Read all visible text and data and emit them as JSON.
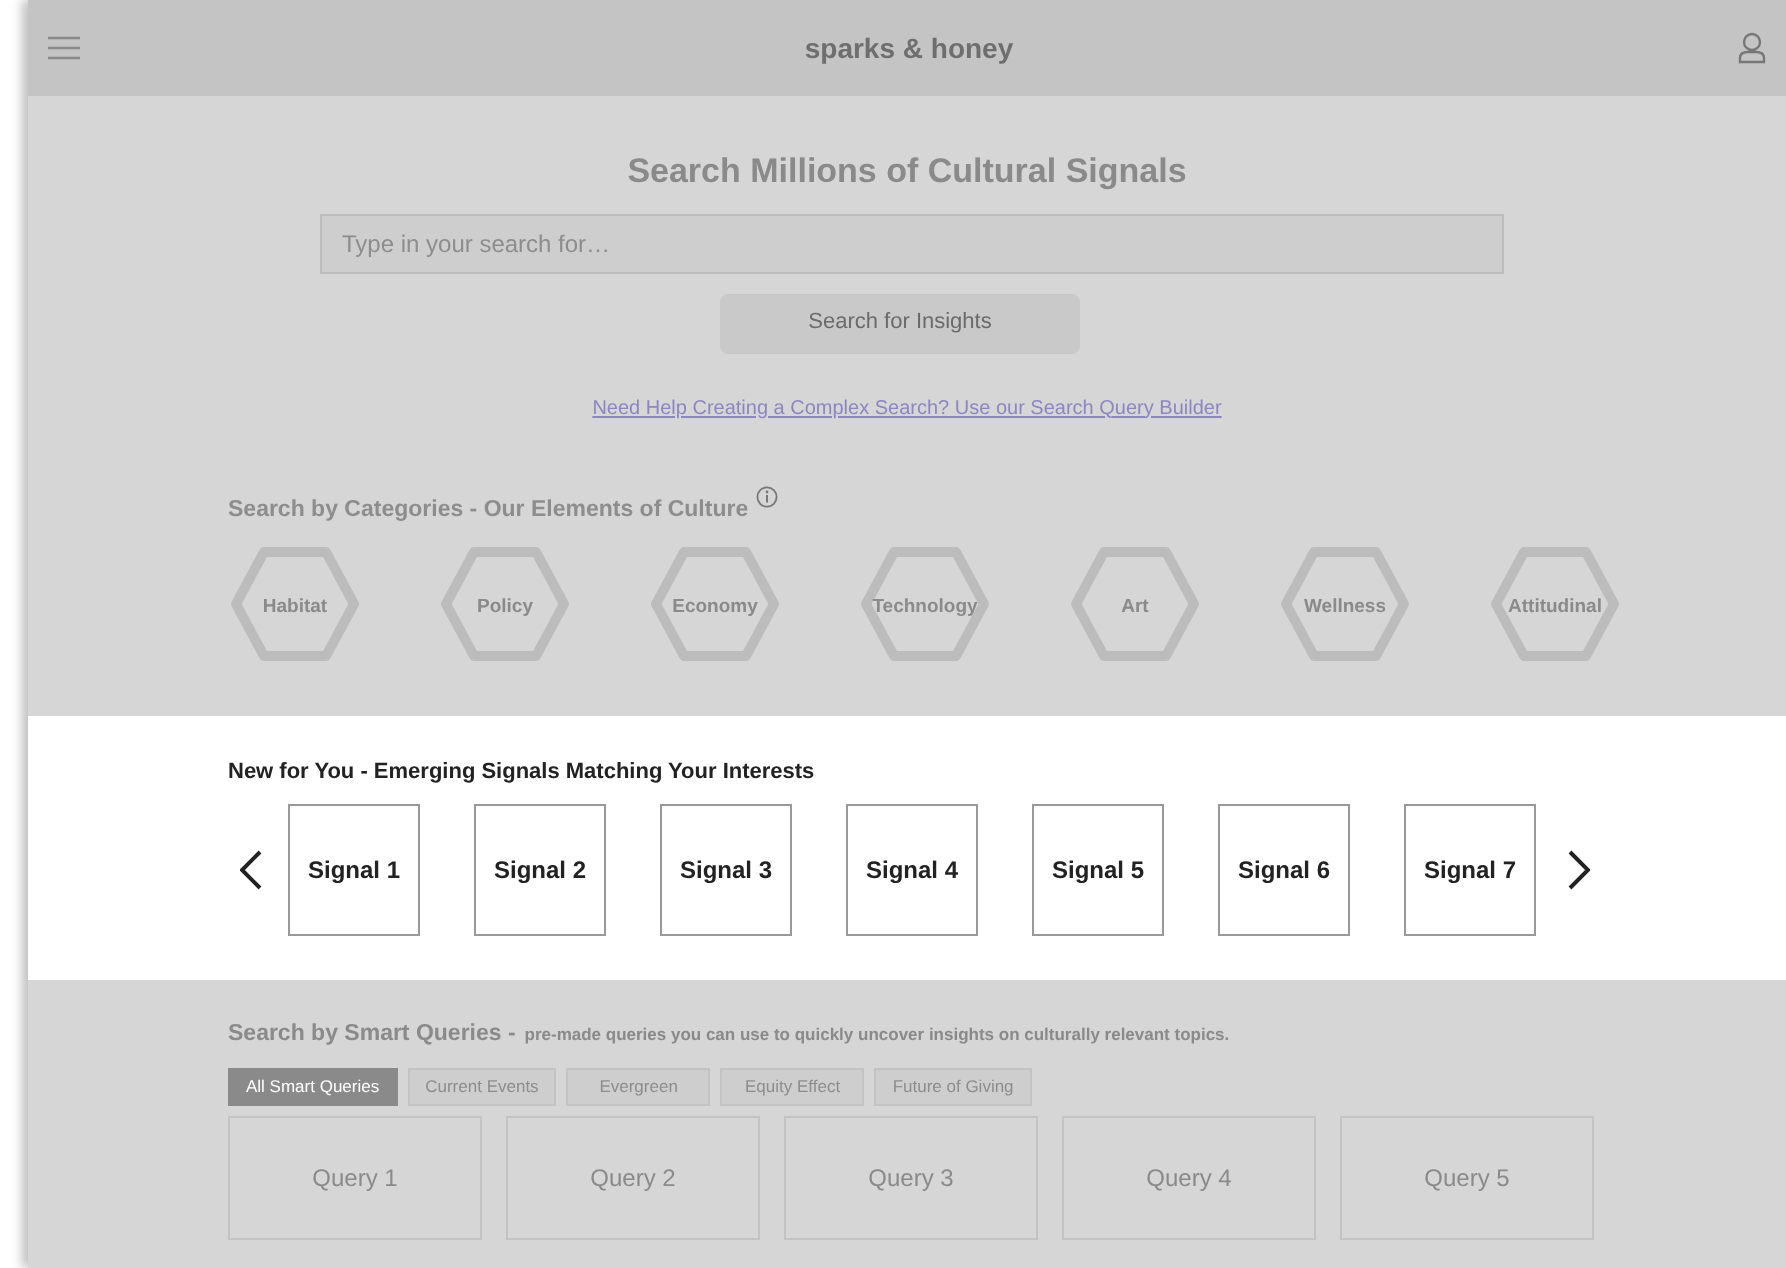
{
  "header": {
    "title": "sparks & honey"
  },
  "search": {
    "heading": "Search Millions of Cultural Signals",
    "placeholder": "Type in your search for…",
    "button": "Search for Insights",
    "disabled": true,
    "help_link": "Need Help Creating a Complex Search? Use our Search Query Builder"
  },
  "categories": {
    "heading": "Search by Categories - Our Elements of Culture",
    "items": [
      "Habitat",
      "Policy",
      "Economy",
      "Technology",
      "Art",
      "Wellness",
      "Attitudinal"
    ]
  },
  "signals": {
    "heading": "New for You - Emerging Signals Matching Your Interests",
    "items": [
      "Signal 1",
      "Signal 2",
      "Signal 3",
      "Signal 4",
      "Signal 5",
      "Signal 6",
      "Signal 7"
    ]
  },
  "smart_queries": {
    "heading": "Search by Smart Queries -",
    "description": "pre-made queries you can use to quickly uncover insights on culturally relevant topics.",
    "filters": [
      {
        "label": "All Smart Queries",
        "selected": true
      },
      {
        "label": "Current Events",
        "selected": false
      },
      {
        "label": "Evergreen",
        "selected": false
      },
      {
        "label": "Equity Effect",
        "selected": false
      },
      {
        "label": "Future of Giving",
        "selected": false
      }
    ],
    "queries": [
      "Query 1",
      "Query 2",
      "Query 3",
      "Query 4",
      "Query 5"
    ]
  }
}
